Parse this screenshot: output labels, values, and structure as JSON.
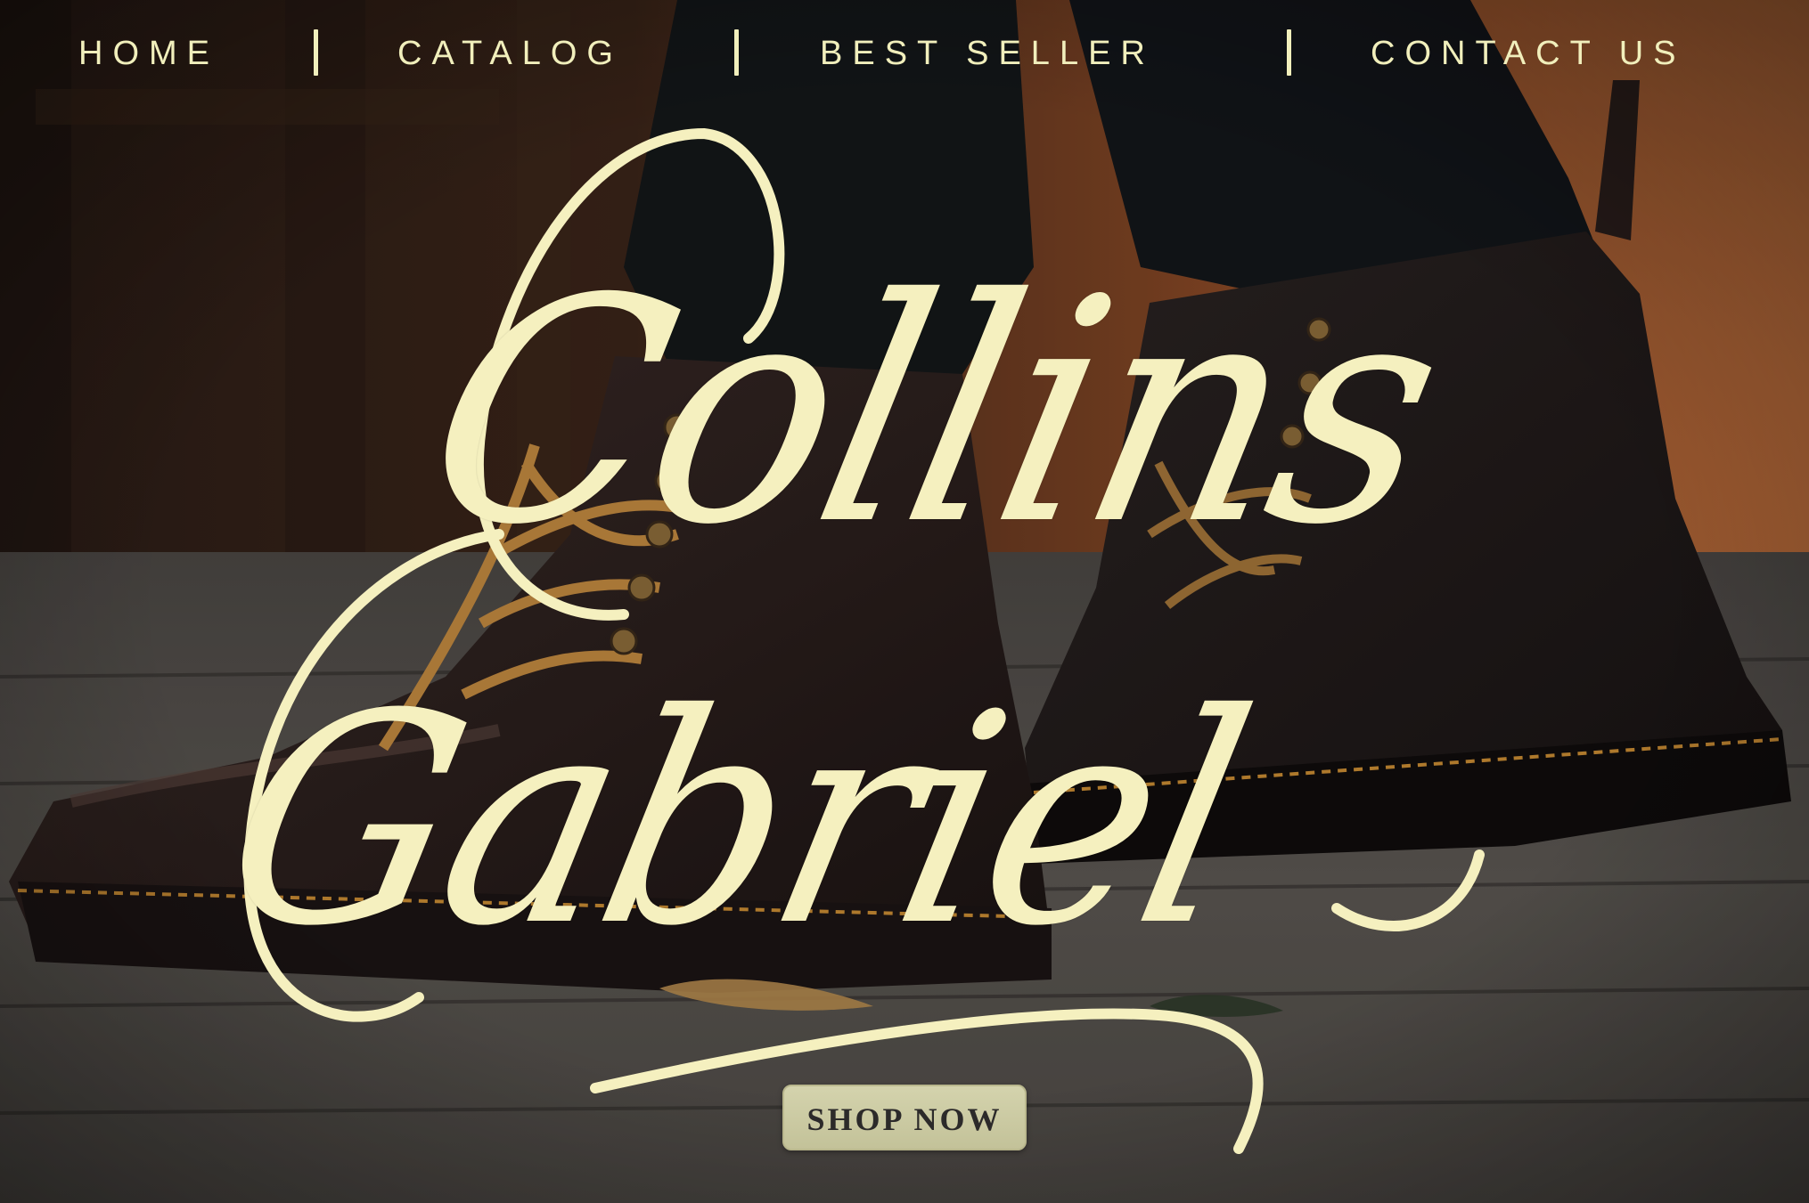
{
  "nav": {
    "items": [
      {
        "label": "HOME"
      },
      {
        "label": "CATALOG"
      },
      {
        "label": "BEST SELLER"
      },
      {
        "label": "CONTACT US"
      }
    ]
  },
  "hero": {
    "title_line1": "Collins",
    "title_line2": "Gabriel",
    "cta_label": "SHOP NOW"
  },
  "colors": {
    "accent_text": "#f1efbc",
    "button_bg": "#cfcea6",
    "button_text": "#2c2a2a"
  }
}
